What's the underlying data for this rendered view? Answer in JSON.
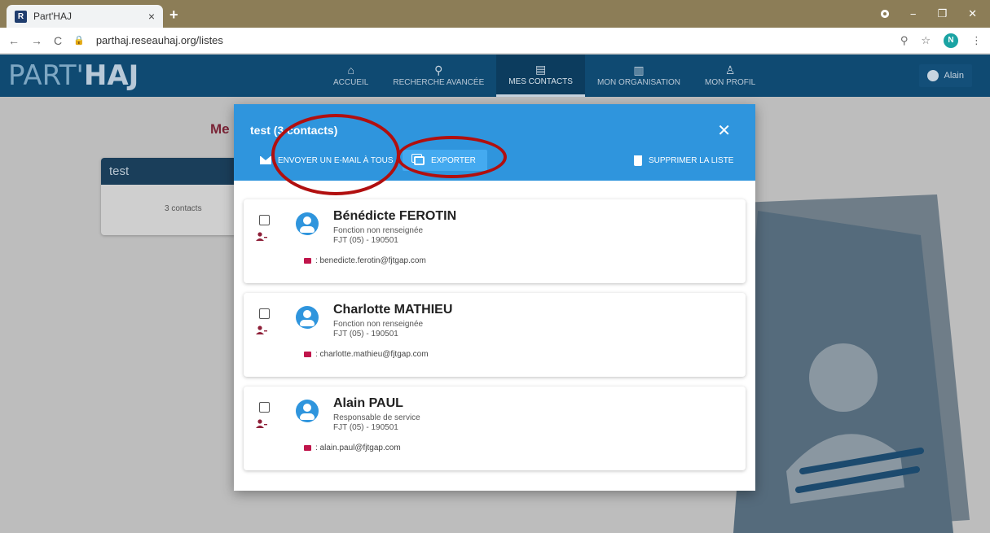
{
  "browser": {
    "tab_title": "Part'HAJ",
    "favicon_text": "R",
    "tab_close": "×",
    "new_tab": "+",
    "url": "parthaj.reseauhaj.org/listes",
    "profile_initial": "N",
    "win_min": "−",
    "win_max": "❐",
    "win_close": "✕"
  },
  "app": {
    "logo_part": "PART'",
    "logo_bold": "HAJ",
    "nav": [
      {
        "label": "ACCUEIL",
        "icon": "home-icon"
      },
      {
        "label": "RECHERCHE AVANCÉE",
        "icon": "search-icon"
      },
      {
        "label": "MES CONTACTS",
        "icon": "contacts-icon"
      },
      {
        "label": "MON ORGANISATION",
        "icon": "building-icon"
      },
      {
        "label": "MON PROFIL",
        "icon": "person-icon"
      }
    ],
    "user_name": "Alain"
  },
  "page": {
    "title_fragment": "Me",
    "list_card": {
      "name": "test",
      "count": "3 contacts"
    }
  },
  "modal": {
    "title": "test (3 contacts)",
    "close": "✕",
    "actions": {
      "mail_all": "ENVOYER UN E-MAIL À TOUS",
      "export": "EXPORTER",
      "delete_list": "SUPPRIMER LA LISTE"
    },
    "contacts": [
      {
        "name": "Bénédicte FEROTIN",
        "function": "Fonction non renseignée",
        "org": "FJT (05) - 190501",
        "email": ": benedicte.ferotin@fjtgap.com"
      },
      {
        "name": "Charlotte MATHIEU",
        "function": "Fonction non renseignée",
        "org": "FJT (05) - 190501",
        "email": ": charlotte.mathieu@fjtgap.com"
      },
      {
        "name": "Alain PAUL",
        "function": "Responsable de service",
        "org": "FJT (05) - 190501",
        "email": ": alain.paul@fjtgap.com"
      }
    ]
  },
  "colors": {
    "header_blue": "#0f4a72",
    "modal_blue": "#2f95dd",
    "accent_red": "#b10f0f",
    "mail_red": "#c0154b"
  }
}
